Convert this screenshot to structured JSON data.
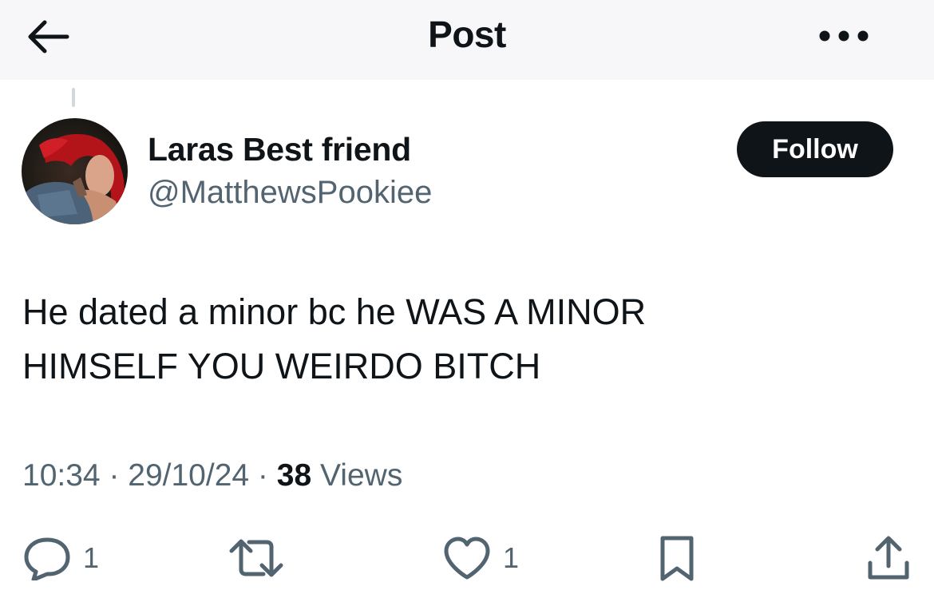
{
  "header": {
    "title": "Post",
    "back_icon": "arrow-left-icon",
    "more_icon": "more-horizontal-icon"
  },
  "author": {
    "display_name": "Laras Best friend",
    "handle": "@MatthewsPookiee",
    "avatar_icon": "avatar-photo"
  },
  "follow_button": {
    "label": "Follow"
  },
  "post": {
    "text_lines": [
      "He dated a minor bc he WAS A MINOR",
      "HIMSELF YOU WEIRDO BITCH"
    ],
    "time": "10:34",
    "separator": " · ",
    "date": "29/10/24",
    "views_count": "38",
    "views_label": "Views"
  },
  "actions": {
    "reply": {
      "icon": "reply-icon",
      "count": "1"
    },
    "repost": {
      "icon": "repost-icon",
      "count": ""
    },
    "like": {
      "icon": "heart-icon",
      "count": "1"
    },
    "bookmark": {
      "icon": "bookmark-icon",
      "count": ""
    },
    "share": {
      "icon": "share-icon",
      "count": ""
    }
  },
  "colors": {
    "text_primary": "#0f1419",
    "text_secondary": "#536471",
    "follow_bg": "#0f1419",
    "follow_text": "#ffffff",
    "header_bg": "#f7f7f9"
  }
}
